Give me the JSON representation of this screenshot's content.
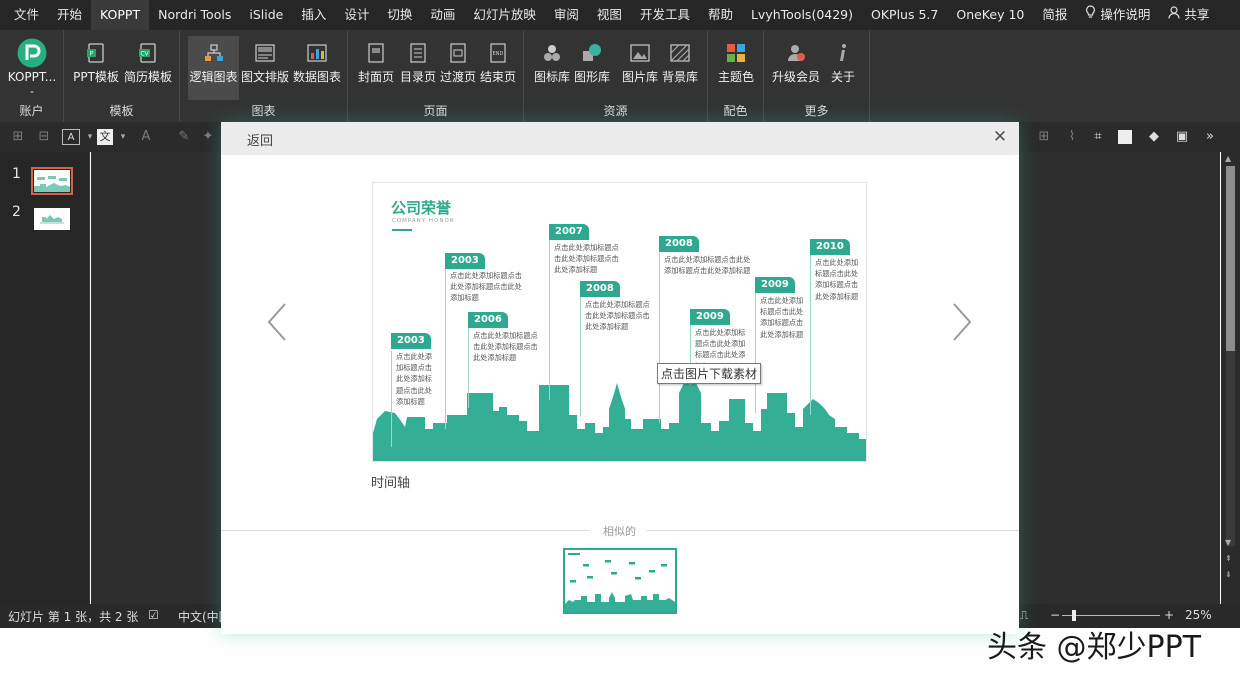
{
  "menu": {
    "tabs": [
      "文件",
      "开始",
      "KOPPT",
      "Nordri Tools",
      "iSlide",
      "插入",
      "设计",
      "切换",
      "动画",
      "幻灯片放映",
      "审阅",
      "视图",
      "开发工具",
      "帮助",
      "LvyhTools(0429)",
      "OKPlus 5.7",
      "OneKey 10",
      "简报"
    ],
    "active_tab": "KOPPT",
    "help_label": "操作说明",
    "share_label": "共享"
  },
  "ribbon": {
    "account": {
      "button": "KOPPT...",
      "group": "账户"
    },
    "template": {
      "buttons": [
        "PPT模板",
        "简历模板"
      ],
      "group": "模板"
    },
    "chart": {
      "buttons": [
        "逻辑图表",
        "图文排版",
        "数据图表"
      ],
      "group": "图表"
    },
    "page": {
      "buttons": [
        "封面页",
        "目录页",
        "过渡页",
        "结束页"
      ],
      "group": "页面"
    },
    "resource": {
      "buttons": [
        "图标库",
        "图形库",
        "图片库",
        "背景库"
      ],
      "group": "资源"
    },
    "color": {
      "buttons": [
        "主题色"
      ],
      "group": "配色"
    },
    "more": {
      "buttons": [
        "升级会员",
        "关于"
      ],
      "group": "更多"
    }
  },
  "slides": {
    "numbers": [
      "1",
      "2"
    ],
    "selected": 1
  },
  "status": {
    "slide_info": "幻灯片 第 1 张，共 2 张",
    "language": "中文(中国)",
    "zoom": "25%"
  },
  "dialog": {
    "back_label": "返回",
    "preview": {
      "title": "公司荣誉",
      "subtitle": "COMPANY HONOR",
      "milestones": [
        {
          "year": "2003",
          "text": "点击此处添加标题点击此处添加标题点击此处添加标题"
        },
        {
          "year": "2003",
          "text": "点击此处添加标题点击此处添加标题点击此处添加标题"
        },
        {
          "year": "2006",
          "text": "点击此处添加标题点击此处添加标题点击此处添加标题"
        },
        {
          "year": "2007",
          "text": "点击此处添加标题点击此处添加标题点击此处添加标题"
        },
        {
          "year": "2008",
          "text": "点击此处添加标题点击此处添加标题点击此处添加标题"
        },
        {
          "year": "2008",
          "text": "点击此处添加标题点击此处添加标题点击此处添加标题"
        },
        {
          "year": "2009",
          "text": "点击此处添加标题点击此处添加标题点击此处添加标题"
        },
        {
          "year": "2009",
          "text": "点击此处添加标题点击此处添加标题点击此处添加标题"
        },
        {
          "year": "2010",
          "text": "点击此处添加标题点击此处添加标题点击此处添加标题"
        }
      ]
    },
    "tooltip": "点击图片下载素材",
    "caption": "时间轴",
    "similar_label": "相似的"
  },
  "watermark": "头条 @郑少PPT",
  "colors": {
    "accent": "#2ea98f",
    "tab_bar": "#262626",
    "ribbon": "#333333"
  }
}
